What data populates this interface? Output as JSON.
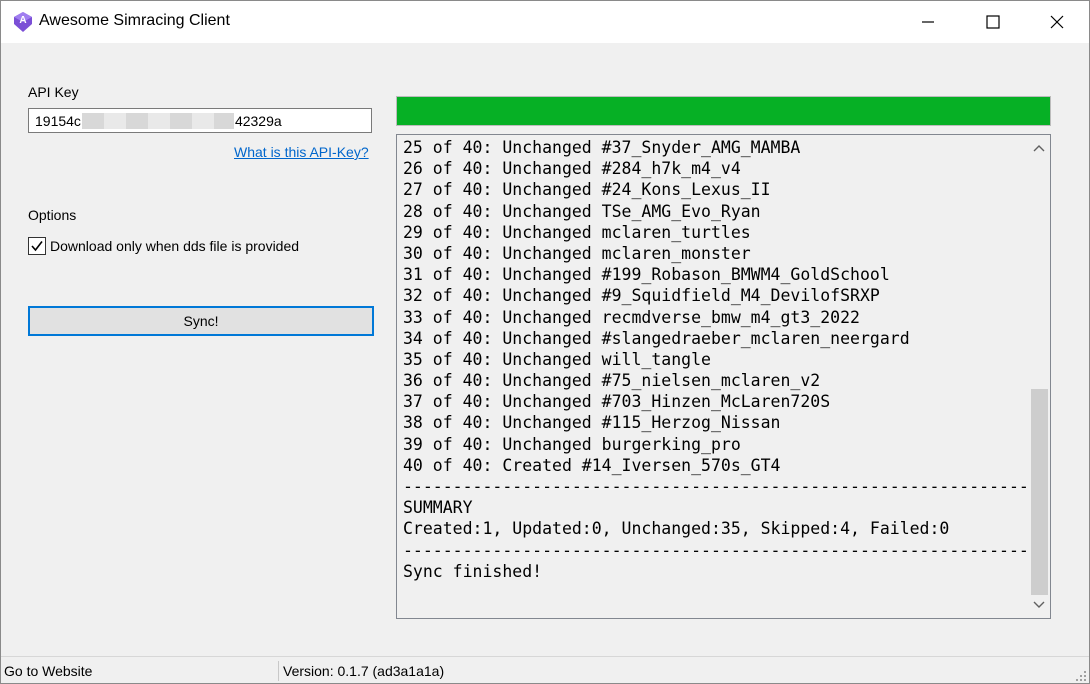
{
  "window": {
    "title": "Awesome Simracing Client",
    "app_icon": "app-logo-icon",
    "controls": [
      "minimize-icon",
      "maximize-icon",
      "close-icon"
    ]
  },
  "form": {
    "api_key_label": "API Key",
    "api_key_prefix": "19154c",
    "api_key_suffix": "42329a",
    "api_key_help_link": "What is this API-Key?",
    "options_label": "Options",
    "download_checkbox_label": "Download only when dds file is provided",
    "download_checkbox_checked": true,
    "sync_button_label": "Sync!"
  },
  "progress": {
    "value_percent": 100,
    "color": "#06b025"
  },
  "log": {
    "lines": [
      "25 of 40: Unchanged #37_Snyder_AMG_MAMBA",
      "26 of 40: Unchanged #284_h7k_m4_v4",
      "27 of 40: Unchanged #24_Kons_Lexus_II",
      "28 of 40: Unchanged TSe_AMG_Evo_Ryan",
      "29 of 40: Unchanged mclaren_turtles",
      "30 of 40: Unchanged mclaren_monster",
      "31 of 40: Unchanged #199_Robason_BMWM4_GoldSchool",
      "32 of 40: Unchanged #9_Squidfield_M4_DevilofSRXP",
      "33 of 40: Unchanged recmdverse_bmw_m4_gt3_2022",
      "34 of 40: Unchanged #slangedraeber_mclaren_neergard",
      "35 of 40: Unchanged will_tangle",
      "36 of 40: Unchanged #75_nielsen_mclaren_v2",
      "37 of 40: Unchanged #703_Hinzen_McLaren720S",
      "38 of 40: Unchanged #115_Herzog_Nissan",
      "39 of 40: Unchanged burgerking_pro",
      "40 of 40: Created #14_Iversen_570s_GT4",
      "---------------------------------------------------------------",
      "SUMMARY",
      "Created:1, Updated:0, Unchanged:35, Skipped:4, Failed:0",
      "---------------------------------------------------------------",
      "Sync finished!"
    ]
  },
  "statusbar": {
    "website_link": "Go to Website",
    "version": "Version: 0.1.7 (ad3a1a1a)"
  }
}
